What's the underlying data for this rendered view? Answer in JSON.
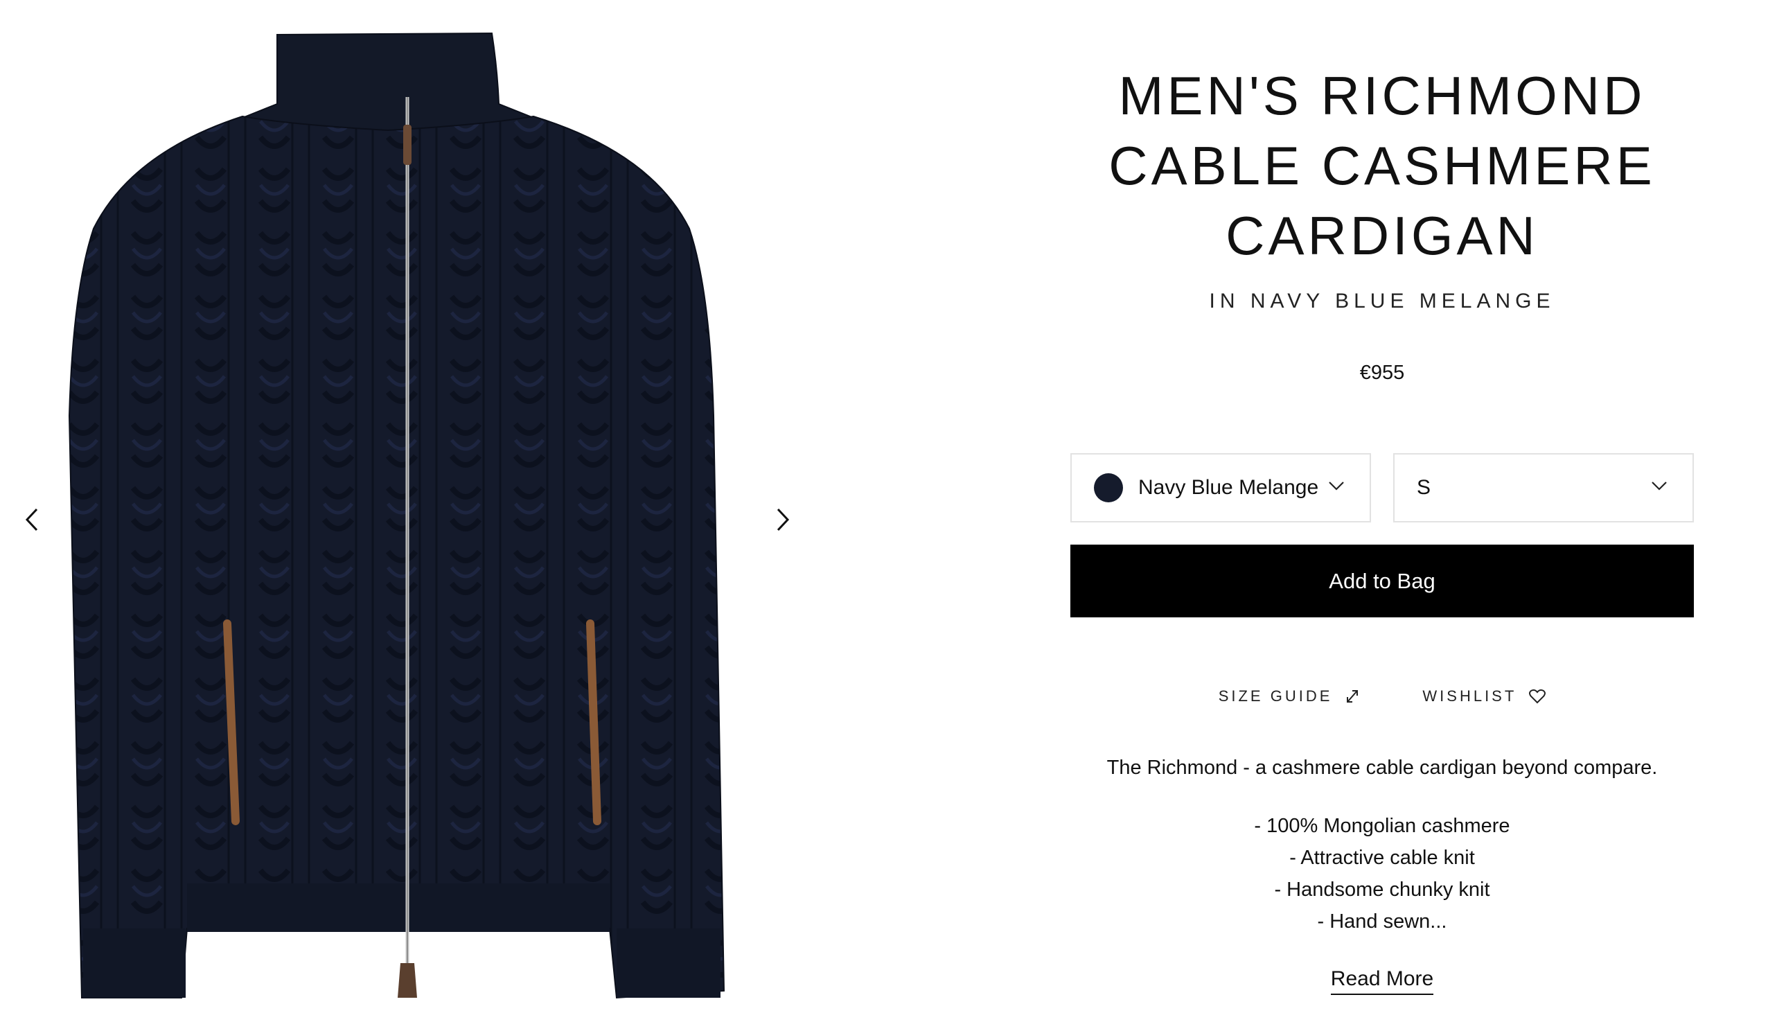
{
  "gallery": {
    "prev_icon": "chevron-left-icon",
    "next_icon": "chevron-right-icon",
    "image_subject": "navy cable knit zip cardigan"
  },
  "product": {
    "title_lines": [
      "MEN'S RICHMOND",
      "CABLE CASHMERE",
      "CARDIGAN"
    ],
    "subtitle": "IN NAVY BLUE MELANGE",
    "price": "€955"
  },
  "options": {
    "color": {
      "value": "Navy Blue Melange",
      "swatch": "#151b2c",
      "icon": "chevron-down-icon"
    },
    "size": {
      "value": "S",
      "icon": "chevron-down-icon"
    }
  },
  "actions": {
    "add_to_bag": "Add to Bag",
    "size_guide": "SIZE GUIDE",
    "size_guide_icon": "expand-icon",
    "wishlist": "WISHLIST",
    "wishlist_icon": "heart-icon",
    "read_more": "Read More"
  },
  "description": {
    "intro": "The Richmond - a cashmere cable cardigan beyond compare.",
    "bullets": [
      "- 100% Mongolian cashmere",
      "- Attractive cable knit",
      "- Handsome chunky knit",
      "- Hand sewn..."
    ]
  },
  "colors": {
    "button_bg": "#000000",
    "garment": "#141a2b",
    "suede_trim": "#8a5a36"
  }
}
